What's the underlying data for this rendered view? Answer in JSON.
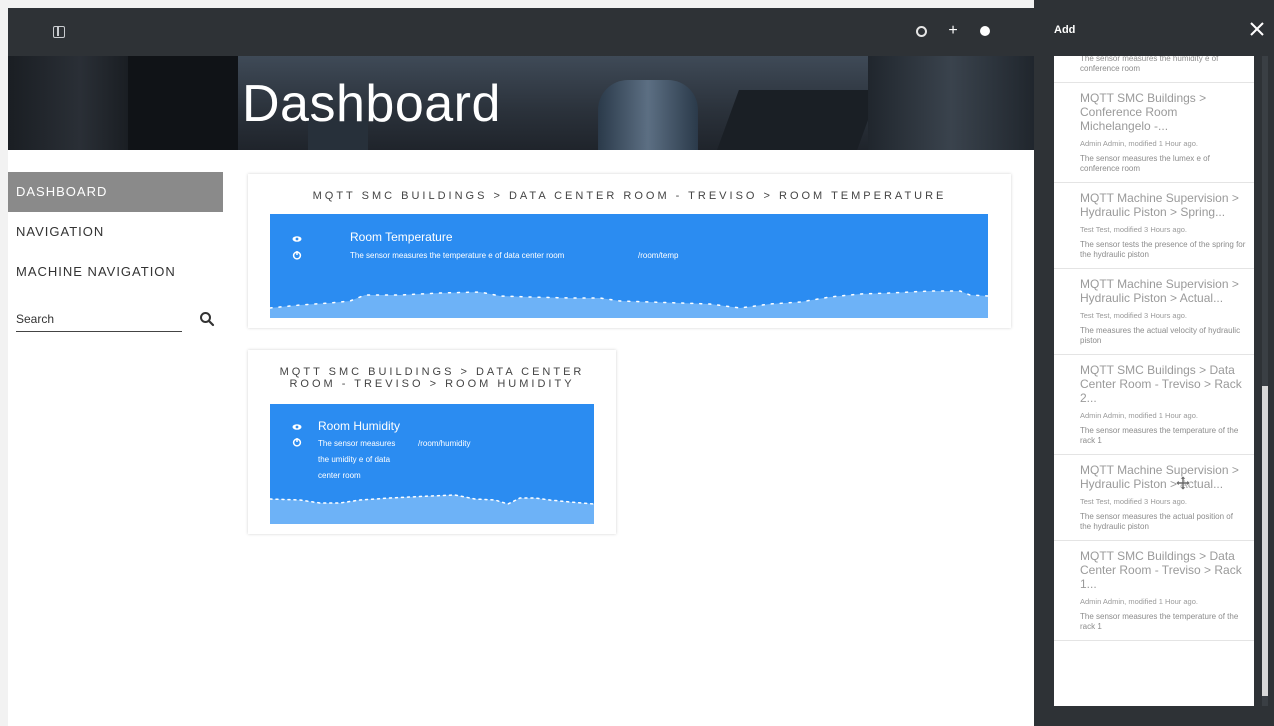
{
  "topbar": {
    "icons": [
      "sidebar-toggle-icon",
      "gear-icon",
      "plus-icon",
      "circle-icon"
    ],
    "plus_glyph": "+"
  },
  "banner": {
    "title": "Dashboard"
  },
  "sidebar": {
    "items": [
      {
        "label": "DASHBOARD",
        "active": true
      },
      {
        "label": "NAVIGATION",
        "active": false
      },
      {
        "label": "MACHINE NAVIGATION",
        "active": false
      }
    ],
    "search": {
      "placeholder": "Search"
    }
  },
  "widgets": [
    {
      "title": "MQTT SMC BUILDINGS > DATA CENTER ROOM - TREVISO > ROOM TEMPERATURE",
      "sensor_name": "Room Temperature",
      "description": "The sensor measures the temperature e of data center room",
      "topic": "/room/temp",
      "color": "#2b8cf1"
    },
    {
      "title_line1": "MQTT SMC BUILDINGS > DATA CENTER",
      "title_line2": "ROOM - TREVISO > ROOM HUMIDITY",
      "sensor_name": "Room Humidity",
      "description_line1": "The sensor measures",
      "description_line2": "the umidity e of data",
      "description_line3": "center room",
      "topic": "/room/humidity",
      "color": "#2b8cf1"
    }
  ],
  "panel": {
    "title": "Add",
    "close_icon": "close-icon",
    "cards": [
      {
        "title": "",
        "meta": "",
        "desc": "The sensor measures the humidity e of conference room"
      },
      {
        "title": "MQTT SMC Buildings > Conference Room Michelangelo -...",
        "meta": "Admin Admin, modified 1 Hour ago.",
        "desc": "The sensor measures the lumex e of conference room"
      },
      {
        "title": "MQTT Machine Supervision > Hydraulic Piston > Spring...",
        "meta": "Test Test, modified 3 Hours ago.",
        "desc": "The sensor tests the presence of the spring for the hydraulic piston"
      },
      {
        "title": "MQTT Machine Supervision > Hydraulic Piston > Actual...",
        "meta": "Test Test, modified 3 Hours ago.",
        "desc": "The measures the actual velocity of hydraulic piston"
      },
      {
        "title": "MQTT SMC Buildings > Data Center Room - Treviso > Rack 2...",
        "meta": "Admin Admin, modified 1 Hour ago.",
        "desc": "The sensor measures the temperature of the rack 1"
      },
      {
        "title": "MQTT Machine Supervision > Hydraulic Piston > Actual...",
        "meta": "Test Test, modified 3 Hours ago.",
        "desc": "The sensor measures the actual position of the hydraulic piston"
      },
      {
        "title": "MQTT SMC Buildings > Data Center Room - Treviso > Rack 1...",
        "meta": "Admin Admin, modified 1 Hour ago.",
        "desc": "The sensor measures the temperature of the rack 1"
      }
    ]
  },
  "colors": {
    "topbar": "#2e3236",
    "accent": "#2b8cf1",
    "active_nav": "#8a8a8a"
  }
}
